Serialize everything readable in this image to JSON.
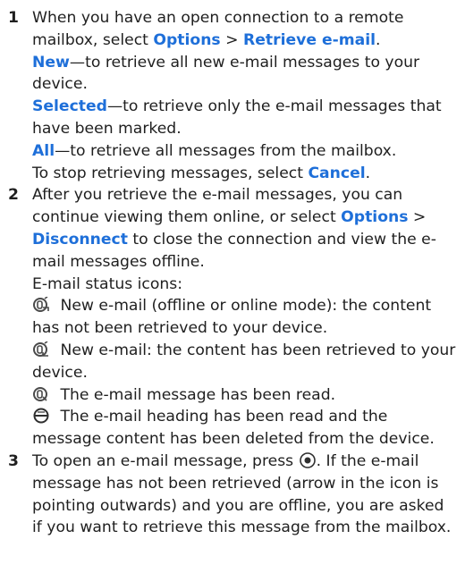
{
  "steps": [
    {
      "num": "1",
      "p1_a": "When you have an open connection to a remote mailbox, select ",
      "p1_opt": "Options",
      "p1_sep": " > ",
      "p1_retrieve": "Retrieve e-mail",
      "p1_end": ".",
      "new_label": "New",
      "new_text": "—to retrieve all new e-mail messages to your device.",
      "selected_label": "Selected",
      "selected_text": "—to retrieve only the e-mail messages that have been marked.",
      "all_label": "All",
      "all_text": "—to retrieve all messages from the mailbox.",
      "stop_text": "To stop retrieving messages, select ",
      "cancel_label": "Cancel",
      "stop_end": "."
    },
    {
      "num": "2",
      "p_a": "After you retrieve the e-mail messages, you can continue viewing them online, or select ",
      "opt_label": "Options",
      "sep": " > ",
      "disconnect_label": "Disconnect",
      "p_b": " to close the connection and view the e-mail messages offline.",
      "status_title": "E-mail status icons:",
      "icons": [
        {
          "icon": "new-email-not-retrieved-icon",
          "text": " New e-mail (offline or online mode): the content has not been retrieved to your device."
        },
        {
          "icon": "new-email-retrieved-icon",
          "text": " New e-mail: the content has been retrieved to your device."
        },
        {
          "icon": "email-read-icon",
          "text": " The e-mail message has been read."
        },
        {
          "icon": "email-heading-read-icon",
          "text": " The e-mail heading has been read and the message content has been deleted from the device."
        }
      ]
    },
    {
      "num": "3",
      "p_a": "To open an e-mail message, press ",
      "p_b": ". If the e-mail message has not been retrieved (arrow in the icon is pointing outwards) and you are offline, you are asked if you want to retrieve this message from the mailbox."
    }
  ]
}
